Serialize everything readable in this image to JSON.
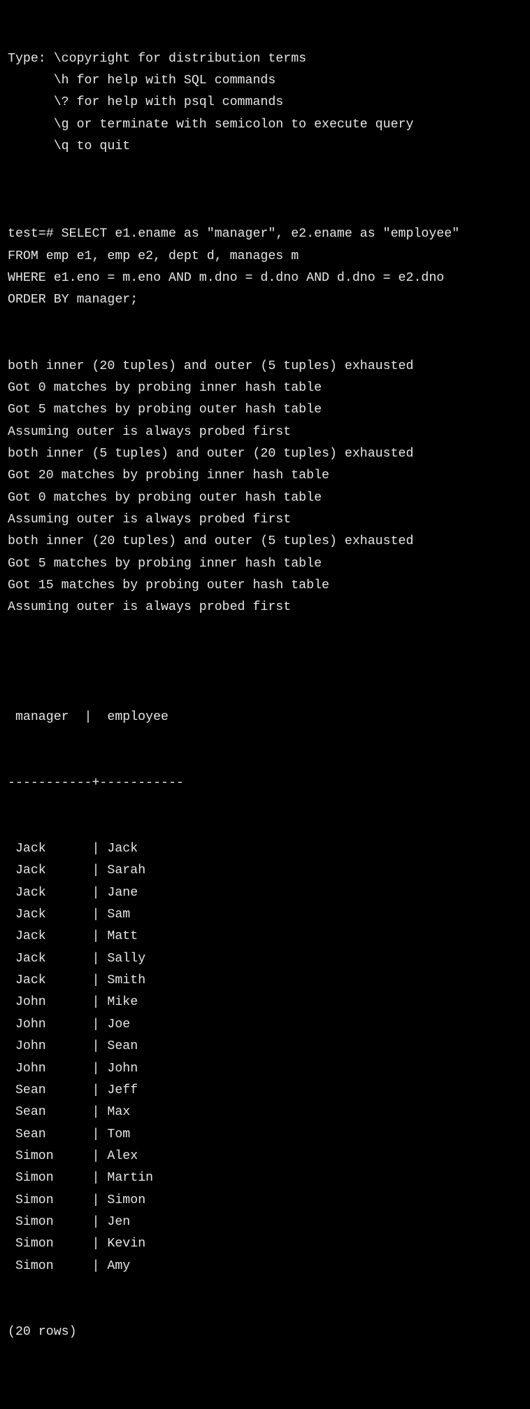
{
  "terminal": {
    "banner": [
      "Type: \\copyright for distribution terms",
      "      \\h for help with SQL commands",
      "      \\? for help with psql commands",
      "      \\g or terminate with semicolon to execute query",
      "      \\q to quit",
      ""
    ],
    "prompt": "test=# ",
    "query_lines": [
      "SELECT e1.ename as \"manager\", e2.ename as \"employee\"",
      "FROM emp e1, emp e2, dept d, manages m",
      "WHERE e1.eno = m.eno AND m.dno = d.dno AND d.dno = e2.dno",
      "ORDER BY manager;"
    ],
    "log_lines": [
      "both inner (20 tuples) and outer (5 tuples) exhausted",
      "Got 0 matches by probing inner hash table",
      "Got 5 matches by probing outer hash table",
      "Assuming outer is always probed first",
      "both inner (5 tuples) and outer (20 tuples) exhausted",
      "Got 20 matches by probing inner hash table",
      "Got 0 matches by probing outer hash table",
      "Assuming outer is always probed first",
      "both inner (20 tuples) and outer (5 tuples) exhausted",
      "Got 5 matches by probing inner hash table",
      "Got 15 matches by probing outer hash table",
      "Assuming outer is always probed first"
    ],
    "result": {
      "header_line": " manager  |  employee",
      "separator_line": "-----------+-----------",
      "columns": [
        "manager",
        "employee"
      ],
      "rows": [
        [
          "Jack",
          "Jack"
        ],
        [
          "Jack",
          "Sarah"
        ],
        [
          "Jack",
          "Jane"
        ],
        [
          "Jack",
          "Sam"
        ],
        [
          "Jack",
          "Matt"
        ],
        [
          "Jack",
          "Sally"
        ],
        [
          "Jack",
          "Smith"
        ],
        [
          "John",
          "Mike"
        ],
        [
          "John",
          "Joe"
        ],
        [
          "John",
          "Sean"
        ],
        [
          "John",
          "John"
        ],
        [
          "Sean",
          "Jeff"
        ],
        [
          "Sean",
          "Max"
        ],
        [
          "Sean",
          "Tom"
        ],
        [
          "Simon",
          "Alex"
        ],
        [
          "Simon",
          "Martin"
        ],
        [
          "Simon",
          "Simon"
        ],
        [
          "Simon",
          "Jen"
        ],
        [
          "Simon",
          "Kevin"
        ],
        [
          "Simon",
          "Amy"
        ]
      ],
      "footer": "(20 rows)"
    },
    "colors": {
      "background": "#000000",
      "foreground": "#e6e6e6"
    }
  }
}
